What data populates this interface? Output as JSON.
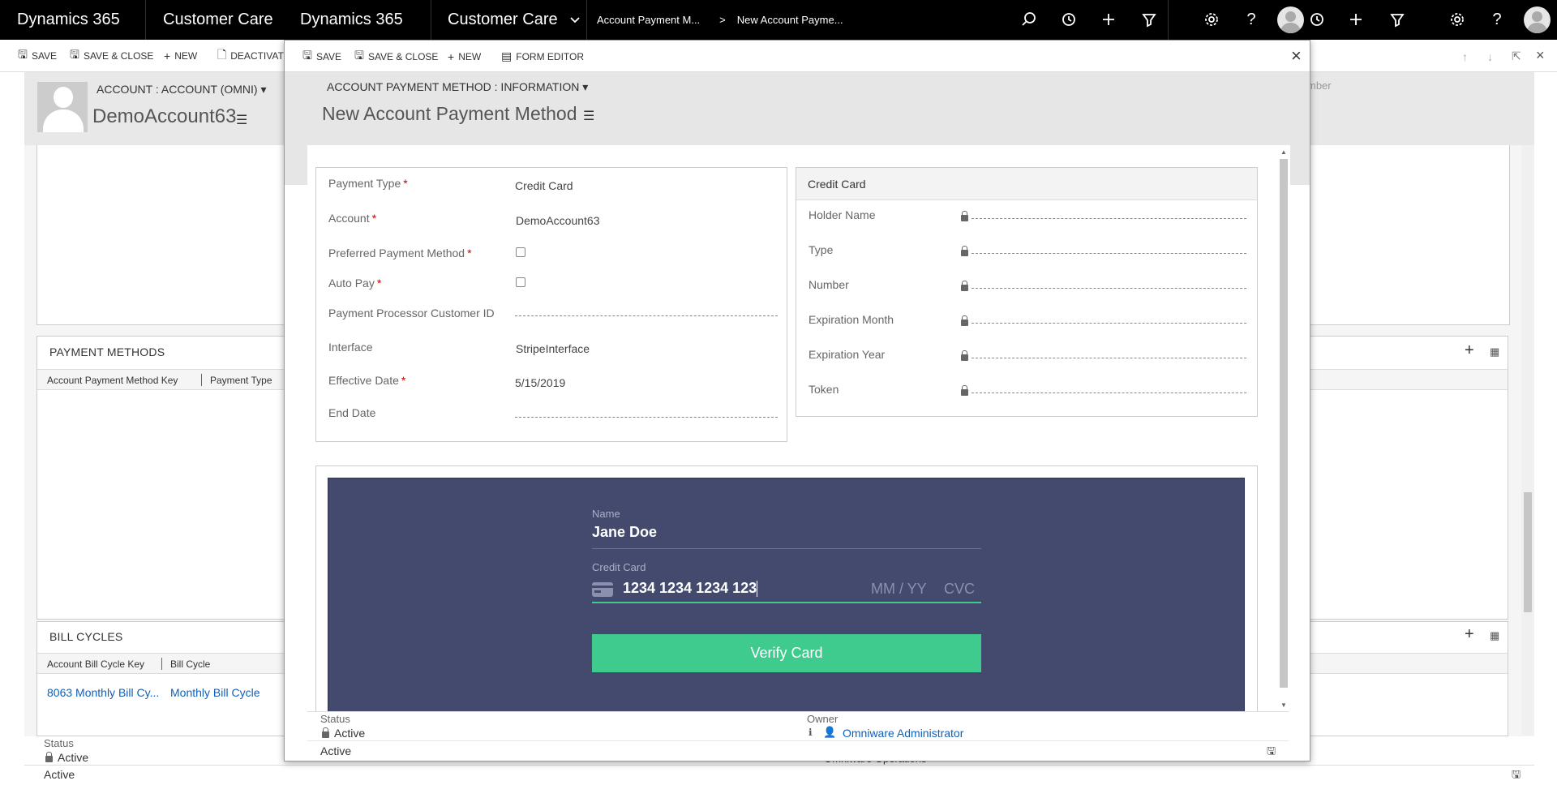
{
  "topbar": {
    "app_name": "Dynamics 365",
    "app_area": "Customer Care",
    "modal_app_name": "Dynamics 365",
    "modal_app_area": "Customer Care",
    "breadcrumb_1": "Account Payment M...",
    "breadcrumb_sep": ">",
    "breadcrumb_2": "New Account Payme..."
  },
  "background": {
    "commands": [
      "SAVE",
      "SAVE & CLOSE",
      "NEW",
      "DEACTIVATE"
    ],
    "form_selector": "ACCOUNT : ACCOUNT (OMNI)",
    "record_name": "DemoAccount63",
    "header_right_label": "mber",
    "payment_methods": {
      "title": "PAYMENT METHODS",
      "columns": [
        "Account Payment Method Key",
        "Payment Type"
      ]
    },
    "bill_cycles": {
      "title": "BILL CYCLES",
      "columns": [
        "Account Bill Cycle Key",
        "Bill Cycle"
      ],
      "rows": [
        {
          "key": "8063 Monthly Bill Cy...",
          "cycle": "Monthly Bill Cycle"
        }
      ]
    },
    "footer": {
      "status_label": "Status",
      "status_value": "Active",
      "bottom_status": "Active",
      "owner_value": "Omniware Operations"
    }
  },
  "modal": {
    "commands": [
      "SAVE",
      "SAVE & CLOSE",
      "NEW",
      "FORM EDITOR"
    ],
    "close_glyph": "×",
    "form_selector": "ACCOUNT PAYMENT METHOD : INFORMATION",
    "title": "New Account Payment Method",
    "fields": {
      "payment_type": {
        "label": "Payment Type",
        "value": "Credit Card"
      },
      "account": {
        "label": "Account",
        "value": "DemoAccount63"
      },
      "preferred": {
        "label": "Preferred Payment Method"
      },
      "auto_pay": {
        "label": "Auto Pay"
      },
      "processor_id": {
        "label": "Payment Processor Customer ID"
      },
      "interface": {
        "label": "Interface",
        "value": "StripeInterface"
      },
      "effective_date": {
        "label": "Effective Date",
        "value": "5/15/2019"
      },
      "end_date": {
        "label": "End Date"
      }
    },
    "credit_card_section": {
      "title": "Credit Card",
      "fields": [
        "Holder Name",
        "Type",
        "Number",
        "Expiration Month",
        "Expiration Year",
        "Token"
      ]
    },
    "stripe": {
      "name_label": "Name",
      "name_value": "Jane Doe",
      "card_label": "Credit Card",
      "card_number": "1234 1234 1234 123",
      "expiry_placeholder": "MM / YY",
      "cvc_placeholder": "CVC",
      "verify_button": "Verify Card"
    },
    "footer": {
      "status_label": "Status",
      "status_value": "Active",
      "owner_label": "Owner",
      "owner_value": "Omniware Administrator",
      "bottom_status": "Active"
    }
  },
  "colors": {
    "stripe_bg": "#434a6e",
    "verify_button": "#3ecb8d",
    "link": "#1160b7",
    "required": "#cc0000"
  }
}
